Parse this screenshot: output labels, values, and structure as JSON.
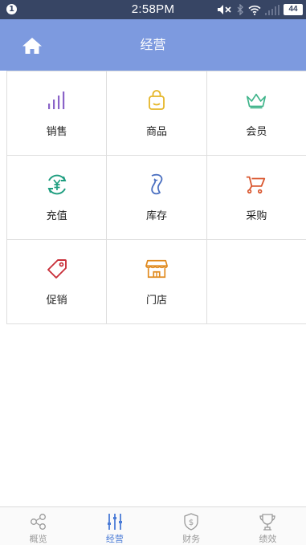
{
  "status_bar": {
    "notification_count": "1",
    "time": "2:58PM",
    "battery": "44",
    "icons": [
      "mute-icon",
      "bluetooth-icon",
      "wifi-icon",
      "signal-icon",
      "battery-icon"
    ]
  },
  "header": {
    "title": "经营",
    "home_icon": "home-icon"
  },
  "grid": {
    "items": [
      {
        "label": "销售",
        "icon": "bar-chart-icon",
        "color": "#8a63c8"
      },
      {
        "label": "商品",
        "icon": "bag-icon",
        "color": "#e5b628"
      },
      {
        "label": "会员",
        "icon": "crown-icon",
        "color": "#3fb48a"
      },
      {
        "label": "充值",
        "icon": "yuan-recharge-icon",
        "color": "#1f9e80"
      },
      {
        "label": "库存",
        "icon": "stock-icon",
        "color": "#4a6fc0"
      },
      {
        "label": "采购",
        "icon": "cart-icon",
        "color": "#d9552d"
      },
      {
        "label": "促销",
        "icon": "tag-icon",
        "color": "#c9303a"
      },
      {
        "label": "门店",
        "icon": "store-icon",
        "color": "#e08a1e"
      }
    ]
  },
  "tab_bar": {
    "tabs": [
      {
        "label": "概览",
        "icon": "share-nodes-icon",
        "active": false
      },
      {
        "label": "经营",
        "icon": "sliders-icon",
        "active": true
      },
      {
        "label": "财务",
        "icon": "money-shield-icon",
        "active": false
      },
      {
        "label": "绩效",
        "icon": "trophy-icon",
        "active": false
      }
    ],
    "active_color": "#4a7bd6",
    "inactive_color": "#9a9a9a"
  }
}
